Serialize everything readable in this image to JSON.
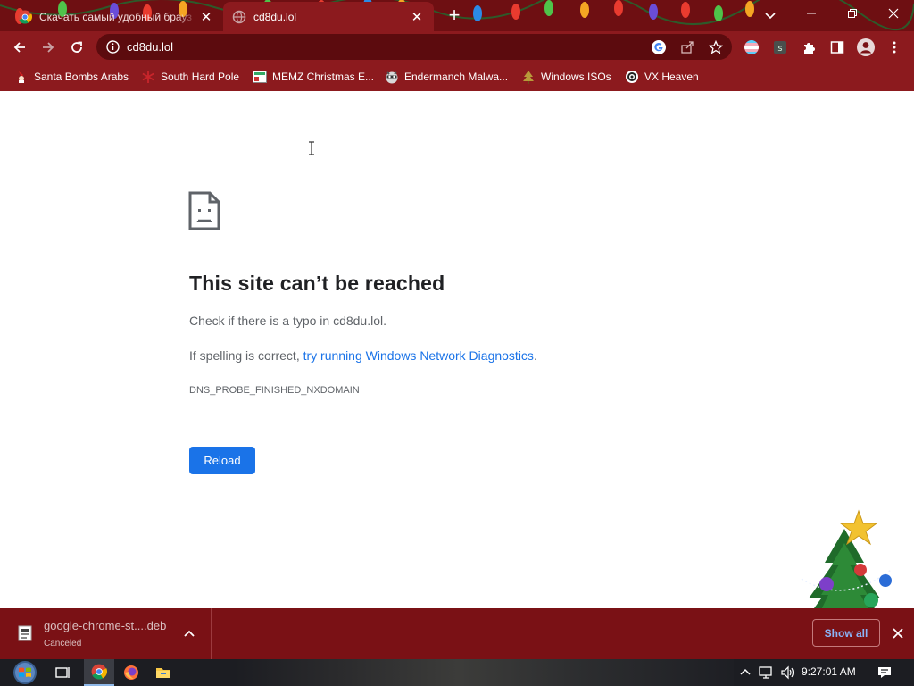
{
  "tabs": [
    {
      "title": "Скачать самый удобный брауз",
      "active": false,
      "favicon": "chrome-icon"
    },
    {
      "title": "cd8du.lol",
      "active": true,
      "favicon": "globe-icon"
    }
  ],
  "omnibox": {
    "url": "cd8du.lol"
  },
  "bookmarks": [
    {
      "label": "Santa Bombs Arabs",
      "icon": "santa-icon"
    },
    {
      "label": "South Hard Pole",
      "icon": "snowflake-icon"
    },
    {
      "label": "MEMZ Christmas E...",
      "icon": "memz-icon"
    },
    {
      "label": "Endermanch Malwa...",
      "icon": "raccoon-icon"
    },
    {
      "label": "Windows ISOs",
      "icon": "tree-icon"
    },
    {
      "label": "VX Heaven",
      "icon": "vx-heaven-icon"
    }
  ],
  "error": {
    "title": "This site can’t be reached",
    "check_text": "Check if there is a typo in cd8du.lol.",
    "spelling_prefix": "If spelling is correct, ",
    "diagnostics_link": "try running Windows Network Diagnostics",
    "spelling_suffix": ".",
    "code": "DNS_PROBE_FINISHED_NXDOMAIN",
    "reload_label": "Reload"
  },
  "download": {
    "filename": "google-chrome-st....deb",
    "status": "Canceled",
    "show_all_label": "Show all"
  },
  "taskbar": {
    "time": "9:27:01 AM"
  },
  "colors": {
    "tabstrip": "#6e0f12",
    "toolbar": "#8c1a1e",
    "omnibox": "#5c0b0e",
    "link": "#1a73e8",
    "button": "#1a73e8",
    "shelf": "#7a1115",
    "taskbar": "#1c1d22"
  }
}
